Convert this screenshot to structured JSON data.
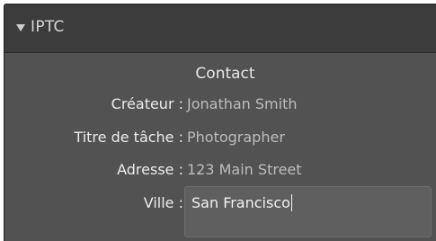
{
  "panel": {
    "title": "IPTC",
    "expanded_icon": "disclosure-triangle-down"
  },
  "section": {
    "title": "Contact"
  },
  "fields": {
    "createur": {
      "label": "Créateur :",
      "value": "Jonathan Smith"
    },
    "titre": {
      "label": "Titre de tâche :",
      "value": "Photographer"
    },
    "adresse": {
      "label": "Adresse :",
      "value": "123 Main Street"
    },
    "ville": {
      "label": "Ville :",
      "value": "San Francisco"
    }
  },
  "colors": {
    "panel_bg": "#525252",
    "header_bg": "#3c3c3c",
    "input_bg": "#5f5f5f"
  }
}
